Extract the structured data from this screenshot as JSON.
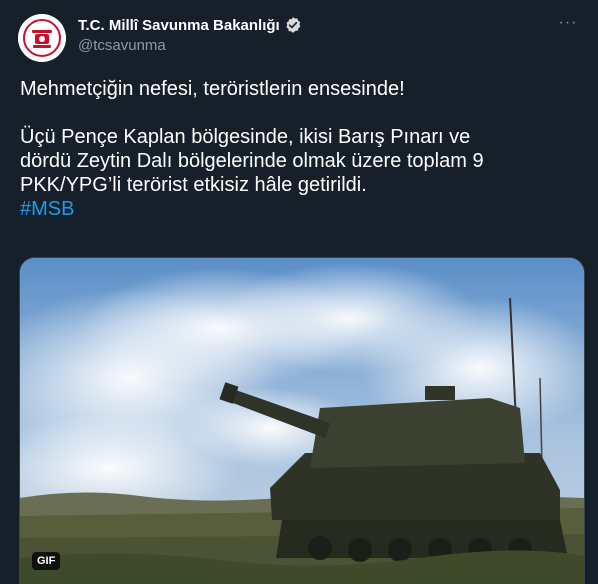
{
  "account": {
    "display_name": "T.C. Millî Savunma Bakanlığı",
    "handle": "@tcsavunma",
    "verified_icon": "verified-badge-icon",
    "avatar_icon": "ministry-emblem-icon"
  },
  "tweet": {
    "line1": "Mehmetçiğin nefesi, teröristlerin ensesinde!",
    "line2": "Üçü Pençe Kaplan bölgesinde, ikisi Barış Pınarı ve",
    "line3": "dördü Zeytin Dalı bölgelerinde olmak üzere toplam 9",
    "line4": "PKK/YPG’li terörist etkisiz hâle getirildi.",
    "hashtag": "#MSB"
  },
  "media": {
    "badge": "GIF",
    "description_icon": "howitzer-firing-image"
  },
  "menu": {
    "more_icon": "more-horizontal-icon",
    "more_label": "···"
  },
  "colors": {
    "background": "#15202b",
    "text": "#ffffff",
    "secondary": "#8b98a5",
    "accent": "#1d9bf0"
  }
}
